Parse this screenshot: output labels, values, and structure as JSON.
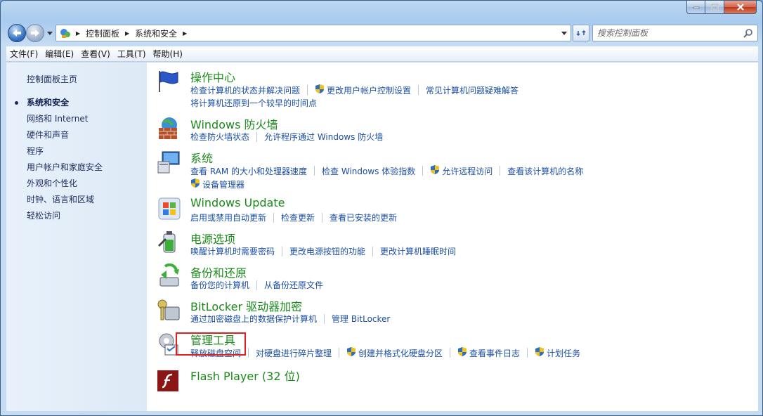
{
  "window": {
    "caption_buttons": [
      "minimize-icon",
      "maximize-icon",
      "close-icon"
    ]
  },
  "address": {
    "crumbs": [
      "控制面板",
      "系统和安全"
    ],
    "search_placeholder": "搜索控制面板"
  },
  "menu": [
    "文件(F)",
    "编辑(E)",
    "查看(V)",
    "工具(T)",
    "帮助(H)"
  ],
  "sidebar": {
    "items": [
      "控制面板主页",
      "系统和安全",
      "网络和 Internet",
      "硬件和声音",
      "程序",
      "用户帐户和家庭安全",
      "外观和个性化",
      "时钟、语言和区域",
      "轻松访问"
    ],
    "current_index": 1
  },
  "categories": [
    {
      "title": "操作中心",
      "icon": "flag-icon",
      "links": [
        [
          {
            "text": "检查计算机的状态并解决问题"
          },
          {
            "text": "更改用户帐户控制设置",
            "shield": true
          },
          {
            "text": "常见计算机问题疑难解答"
          }
        ],
        [
          {
            "text": "将计算机还原到一个较早的时间点"
          }
        ]
      ]
    },
    {
      "title": "Windows 防火墙",
      "icon": "firewall-icon",
      "links": [
        [
          {
            "text": "检查防火墙状态"
          },
          {
            "text": "允许程序通过 Windows 防火墙"
          }
        ]
      ]
    },
    {
      "title": "系统",
      "icon": "computer-icon",
      "links": [
        [
          {
            "text": "查看 RAM 的大小和处理器速度"
          },
          {
            "text": "检查 Windows 体验指数"
          },
          {
            "text": "允许远程访问",
            "shield": true
          },
          {
            "text": "查看该计算机的名称"
          }
        ],
        [
          {
            "text": "设备管理器",
            "shield": true
          }
        ]
      ]
    },
    {
      "title": "Windows Update",
      "icon": "windows-update-icon",
      "links": [
        [
          {
            "text": "启用或禁用自动更新"
          },
          {
            "text": "检查更新"
          },
          {
            "text": "查看已安装的更新"
          }
        ]
      ]
    },
    {
      "title": "电源选项",
      "icon": "battery-icon",
      "links": [
        [
          {
            "text": "唤醒计算机时需要密码"
          },
          {
            "text": "更改电源按钮的功能"
          },
          {
            "text": "更改计算机睡眠时间"
          }
        ]
      ]
    },
    {
      "title": "备份和还原",
      "icon": "backup-icon",
      "links": [
        [
          {
            "text": "备份您的计算机"
          },
          {
            "text": "从备份还原文件"
          }
        ]
      ]
    },
    {
      "title": "BitLocker 驱动器加密",
      "icon": "bitlocker-key-icon",
      "links": [
        [
          {
            "text": "通过加密磁盘上的数据保护计算机"
          },
          {
            "text": "管理 BitLocker"
          }
        ]
      ]
    },
    {
      "title": "管理工具",
      "icon": "admin-tools-icon",
      "links": [
        [
          {
            "text": "释放磁盘空间"
          },
          {
            "text": "对硬盘进行碎片整理"
          },
          {
            "text": "创建并格式化硬盘分区",
            "shield": true
          },
          {
            "text": "查看事件日志",
            "shield": true
          },
          {
            "text": "计划任务",
            "shield": true
          }
        ]
      ]
    },
    {
      "title": "Flash Player (32 位)",
      "icon": "flash-player-icon",
      "links": []
    }
  ],
  "colors": {
    "title_green": "#1b8a1b",
    "link_blue": "#1b4ea3",
    "highlight_red": "#e02020"
  }
}
